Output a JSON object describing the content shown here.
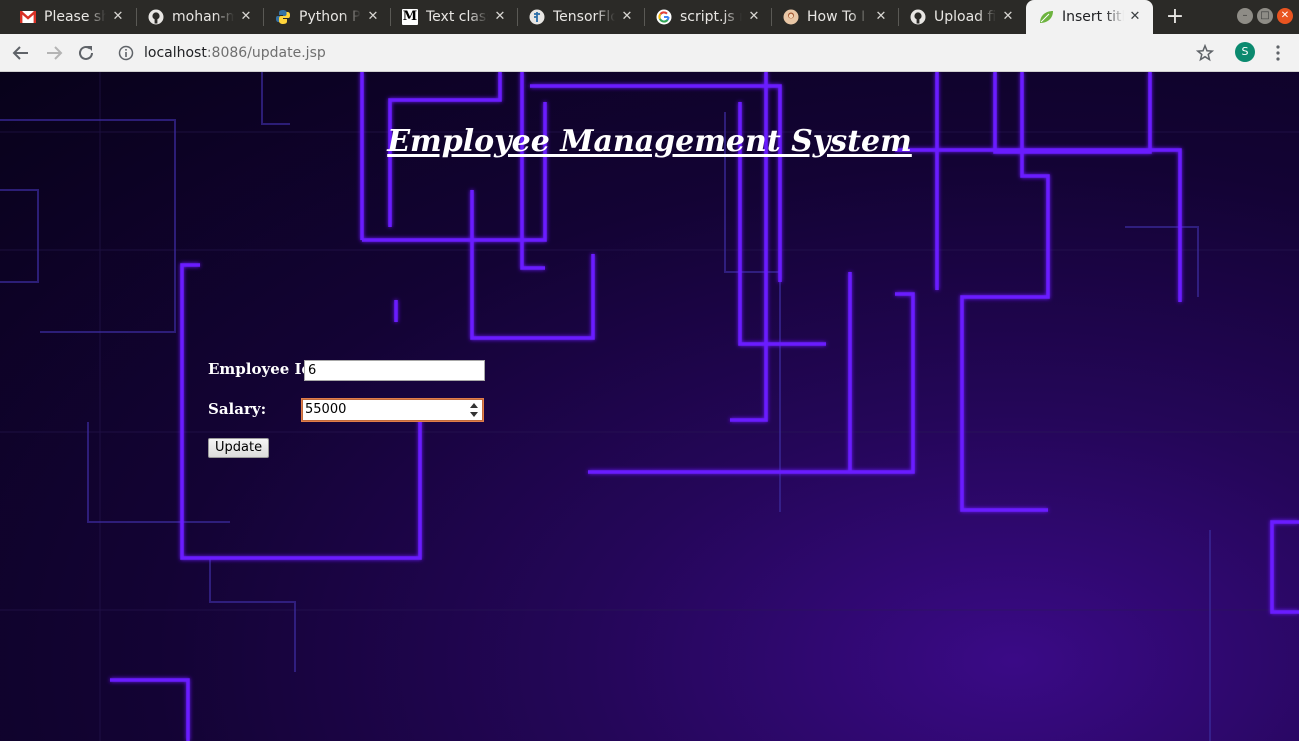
{
  "browser": {
    "tabs": [
      {
        "title": "Please sh",
        "icon": "gmail-icon",
        "active": false
      },
      {
        "title": "mohan-m",
        "icon": "github-icon",
        "active": false
      },
      {
        "title": "Python P",
        "icon": "python-icon",
        "active": false
      },
      {
        "title": "Text class",
        "icon": "medium-icon",
        "active": false
      },
      {
        "title": "TensorFlo",
        "icon": "tensorflow-icon",
        "active": false
      },
      {
        "title": "script.js r",
        "icon": "google-icon",
        "active": false
      },
      {
        "title": "How To I",
        "icon": "avatar-icon",
        "active": false
      },
      {
        "title": "Upload fi",
        "icon": "github-icon",
        "active": false
      },
      {
        "title": "Insert titl",
        "icon": "leaf-icon",
        "active": true
      }
    ],
    "close_glyph": "✕",
    "new_tab_glyph": "+",
    "url": {
      "host": "localhost",
      "rest": ":8086/update.jsp"
    },
    "profile_initial": "S"
  },
  "page": {
    "title": "Employee Management System",
    "form": {
      "employee_id_label": "Employee Id:",
      "employee_id_value": "6",
      "salary_label": "Salary:",
      "salary_value": "55000",
      "submit_label": "Update"
    }
  },
  "colors": {
    "background_dark": "#08021a",
    "neon_line": "#6a1cff",
    "active_tab": "#f2f2f2",
    "tabstrip": "#2b2a27"
  }
}
